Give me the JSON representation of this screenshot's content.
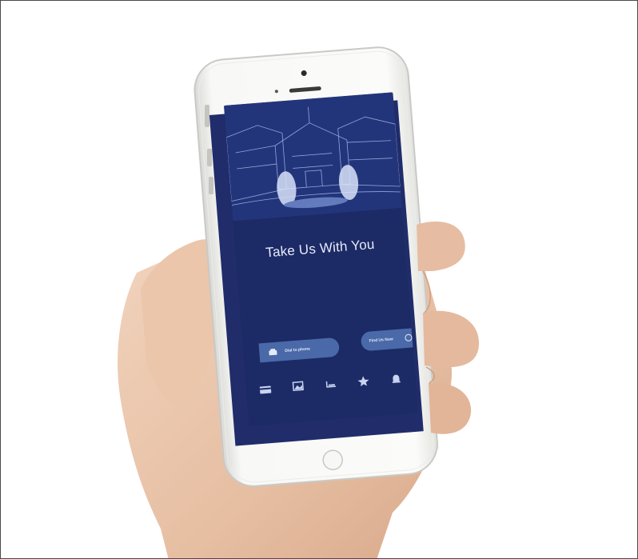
{
  "screen": {
    "headline": "Take Us With You",
    "call_button": {
      "label": "Dial to phone",
      "icon": "phone-icon"
    },
    "find_button": {
      "label": "Find Us Now",
      "icon": "location-ring-icon"
    },
    "tabs": [
      {
        "icon": "card-icon",
        "label": ""
      },
      {
        "icon": "gallery-icon",
        "label": ""
      },
      {
        "icon": "spa-icon",
        "label": ""
      },
      {
        "icon": "star-icon",
        "label": ""
      },
      {
        "icon": "bell-icon",
        "label": ""
      }
    ]
  },
  "colors": {
    "screen_bg": "#1c2a66",
    "button_bg": "#4a69a8",
    "phone_body": "#f4f4f2",
    "skin": "#e9c3a8"
  }
}
